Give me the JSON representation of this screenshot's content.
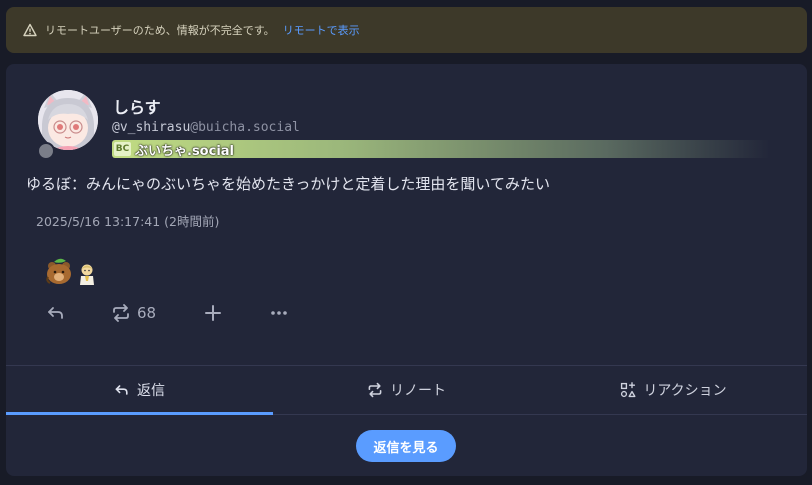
{
  "warning": {
    "text": "リモートユーザーのため、情報が不完全です。",
    "link": "リモートで表示",
    "icon": "warning-triangle-icon"
  },
  "note": {
    "display_name": "しらす",
    "username": "@v_shirasu",
    "host": "@buicha.social",
    "instance_name": "ぶいちゃ.social",
    "instance_icon_text": "BC",
    "text": "ゆるぼ：みんにゃのぶいちゃを始めたきっかけと定着した理由を聞いてみたい",
    "timestamp": "2025/5/16 13:17:41 (2時間前)",
    "renote_count": "68",
    "reactions": [
      "bear-with-leaf-emoji",
      "kneeling-person-emoji"
    ]
  },
  "actions": {
    "reply_icon": "reply-icon",
    "renote_icon": "repeat-icon",
    "react_icon": "plus-icon",
    "more_icon": "more-icon"
  },
  "tabs": [
    {
      "label": "返信",
      "icon": "reply-icon",
      "active": true
    },
    {
      "label": "リノート",
      "icon": "repeat-icon",
      "active": false
    },
    {
      "label": "リアクション",
      "icon": "shapes-icon",
      "active": false
    }
  ],
  "see_replies_label": "返信を見る",
  "colors": {
    "accent": "#5a9cff",
    "background": "#181b27",
    "card": "#222639",
    "warning_bg": "#3d3929"
  }
}
